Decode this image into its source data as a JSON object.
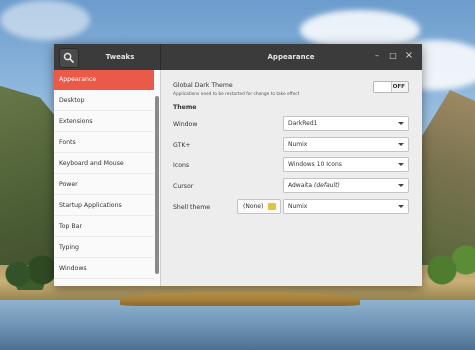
{
  "window": {
    "app_title": "Tweaks",
    "page_title": "Appearance",
    "controls": {
      "minimize": "–",
      "maximize": "□",
      "close": "×"
    }
  },
  "sidebar": {
    "items": [
      {
        "label": "Appearance",
        "active": true
      },
      {
        "label": "Desktop"
      },
      {
        "label": "Extensions"
      },
      {
        "label": "Fonts"
      },
      {
        "label": "Keyboard and Mouse"
      },
      {
        "label": "Power"
      },
      {
        "label": "Startup Applications"
      },
      {
        "label": "Top Bar"
      },
      {
        "label": "Typing"
      },
      {
        "label": "Windows"
      }
    ]
  },
  "appearance": {
    "dark_theme": {
      "label": "Global Dark Theme",
      "note": "Applications need to be restarted for change to take effect",
      "state": "OFF"
    },
    "theme_heading": "Theme",
    "rows": {
      "window": {
        "label": "Window",
        "value": "DarkRed1"
      },
      "gtk": {
        "label": "GTK+",
        "value": "Numix"
      },
      "icons": {
        "label": "Icons",
        "value": "Windows 10 Icons"
      },
      "cursor": {
        "label": "Cursor",
        "value": "Adwaita",
        "value_suffix": "(default)"
      },
      "shell": {
        "label": "Shell theme",
        "file_value": "(None)",
        "value": "Numix"
      }
    }
  },
  "colors": {
    "accent": "#ea5a49",
    "titlebar": "#3b3b3b",
    "sidebar_bg": "#fafafa",
    "content_bg": "#ededed"
  }
}
